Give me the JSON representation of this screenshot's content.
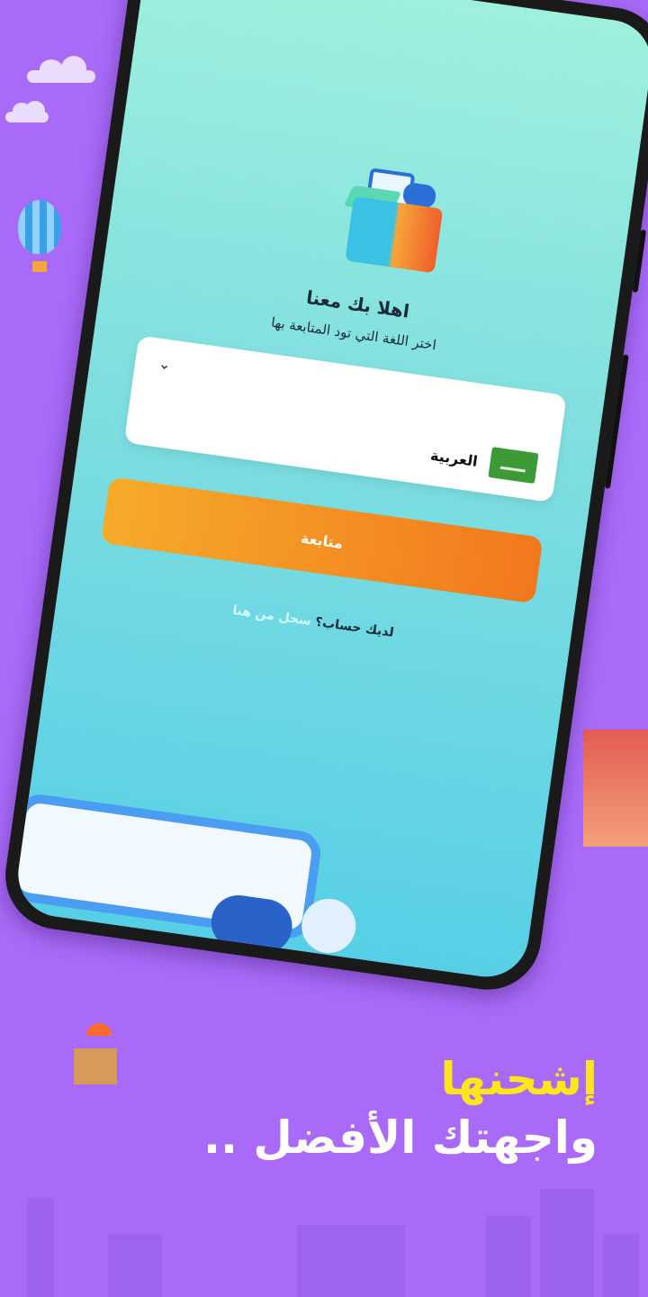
{
  "welcome": {
    "title": "اهلا بك معنا",
    "subtitle": "اختر اللغة التي تود المتابعة بها"
  },
  "language_select": {
    "selected_label": "العربية",
    "flag_icon": "saudi-flag-icon",
    "chevron_icon": "chevron-down-icon"
  },
  "continue_button": {
    "label": "متابعة"
  },
  "account_prompt": {
    "question": "لديك حساب؟",
    "link": "سجل من هنا"
  },
  "promo": {
    "line1": "إشحنها",
    "line2": "واجهتك الأفضل .."
  },
  "colors": {
    "background": "#a86af7",
    "accent_orange": "#f2781d",
    "headline_yellow": "#ffe61a"
  }
}
